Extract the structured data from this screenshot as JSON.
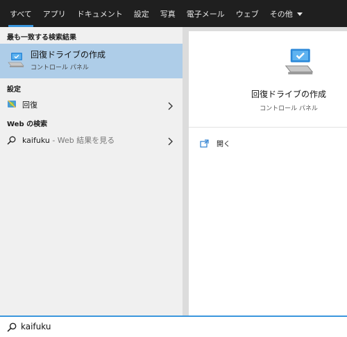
{
  "tabs": [
    {
      "label": "すべて",
      "active": true
    },
    {
      "label": "アプリ"
    },
    {
      "label": "ドキュメント"
    },
    {
      "label": "設定"
    },
    {
      "label": "写真"
    },
    {
      "label": "電子メール"
    },
    {
      "label": "ウェブ"
    },
    {
      "label": "その他",
      "has_dropdown": true
    }
  ],
  "results": {
    "best_match_header": "最も一致する検索結果",
    "best_match": {
      "title": "回復ドライブの作成",
      "subtitle": "コントロール パネル",
      "icon": "monitor-check-icon"
    },
    "settings_header": "設定",
    "settings_item": {
      "label": "回復",
      "icon": "recovery-shield-icon"
    },
    "web_header": "Web の検索",
    "web_item": {
      "query": "kaifuku",
      "suffix": " - Web 結果を見る",
      "icon": "search-icon"
    }
  },
  "detail": {
    "title": "回復ドライブの作成",
    "subtitle": "コントロール パネル",
    "icon": "monitor-check-icon",
    "action_label": "開く",
    "action_icon": "open-icon"
  },
  "search": {
    "value": "kaifuku",
    "icon": "search-icon"
  },
  "colors": {
    "accent": "#3a96dd",
    "selected": "#aecde8",
    "tabbar": "#1f1f1f"
  }
}
